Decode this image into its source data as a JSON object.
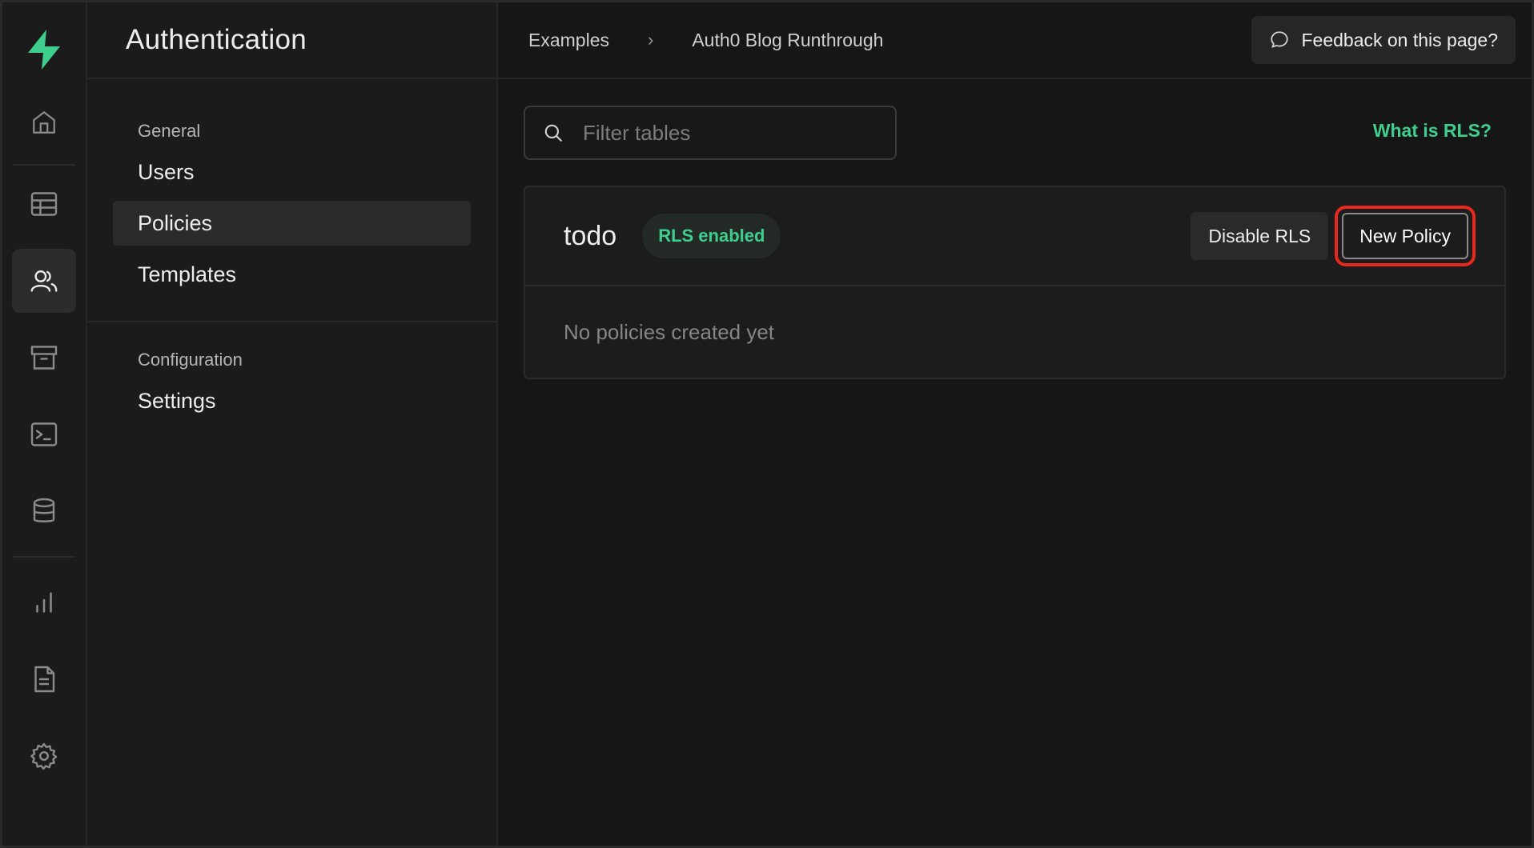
{
  "colors": {
    "accent": "#3ecf8e",
    "highlight": "#e8291c",
    "background": "#161616",
    "panel": "#1b1b1b"
  },
  "rail": {
    "icons": [
      "home-icon",
      "table-icon",
      "users-icon",
      "storage-icon",
      "terminal-icon",
      "database-icon",
      "chart-icon",
      "document-icon",
      "gear-icon"
    ],
    "active": "users-icon"
  },
  "subnav": {
    "title": "Authentication",
    "groups": [
      {
        "label": "General",
        "items": [
          "Users",
          "Policies",
          "Templates"
        ]
      },
      {
        "label": "Configuration",
        "items": [
          "Settings"
        ]
      }
    ],
    "active_item": "Policies"
  },
  "topbar": {
    "breadcrumb": [
      "Examples",
      "Auth0 Blog Runthrough"
    ],
    "separator": "›",
    "feedback_label": "Feedback on this page?"
  },
  "toolbar": {
    "search_placeholder": "Filter tables",
    "search_value": "",
    "rls_link": "What is RLS?"
  },
  "table_card": {
    "table_name": "todo",
    "badge": "RLS enabled",
    "disable_label": "Disable RLS",
    "new_policy_label": "New Policy",
    "empty_text": "No policies created yet"
  }
}
